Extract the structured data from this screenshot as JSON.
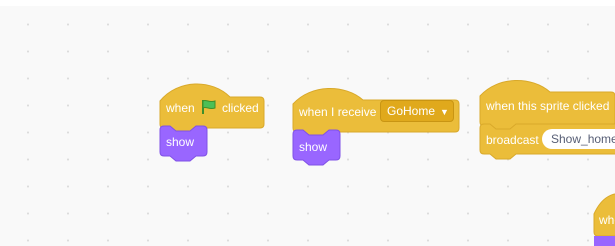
{
  "workspace": {
    "blocks": [
      {
        "id": "hat1",
        "when": "when",
        "clicked": "clicked",
        "flag_icon": "green-flag-icon"
      },
      {
        "id": "show1",
        "label": "show"
      },
      {
        "id": "hat2",
        "label": "when I receive",
        "message": "GoHome"
      },
      {
        "id": "show2",
        "label": "show"
      },
      {
        "id": "hat3",
        "label": "when this sprite clicked"
      },
      {
        "id": "bcast",
        "label": "broadcast",
        "message": "Show_home"
      },
      {
        "id": "partial",
        "label": "whe"
      }
    ]
  },
  "colors": {
    "events": "#ffbf00",
    "events_border": "#cc9900",
    "looks": "#9966ff",
    "looks_border": "#774dcb"
  }
}
